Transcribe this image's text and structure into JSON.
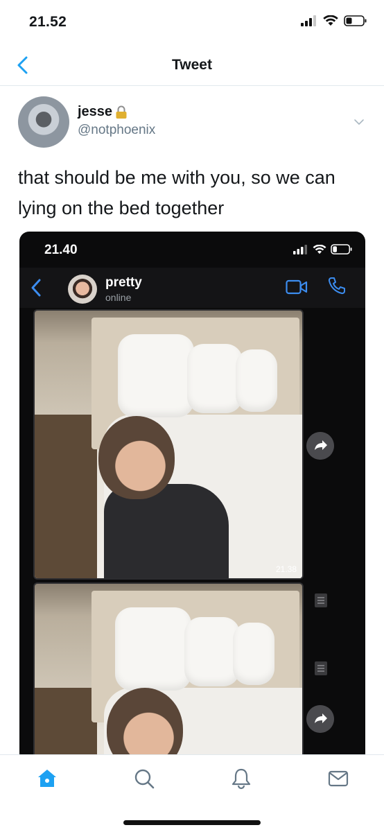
{
  "status_bar": {
    "time": "21.52"
  },
  "nav": {
    "title": "Tweet"
  },
  "tweet": {
    "display_name": "jesse",
    "handle": "@notphoenix",
    "text": "that should be me with you, so we can lying on the bed together"
  },
  "media": {
    "status_time": "21.40",
    "chat": {
      "name": "pretty",
      "presence": "online"
    },
    "photos": [
      {
        "timestamp": "21.38"
      },
      {
        "timestamp": ""
      }
    ]
  },
  "colors": {
    "accent": "#1da1f2",
    "chat_accent": "#3c8df0",
    "text": "#14171a",
    "secondary_text": "#657786"
  },
  "icons": {
    "back": "chevron-left-icon",
    "caret": "chevron-down-icon",
    "lock": "lock-icon",
    "video": "video-camera-icon",
    "call": "phone-icon",
    "share": "share-arrow-icon",
    "tabs": [
      "home-icon",
      "search-icon",
      "bell-icon",
      "mail-icon"
    ]
  }
}
